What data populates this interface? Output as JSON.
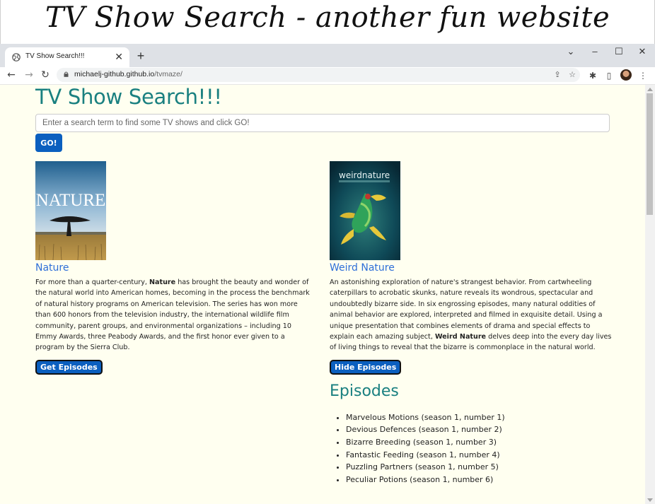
{
  "banner": {
    "title": "TV Show Search - another fun website"
  },
  "browser": {
    "tab_title": "TV Show Search!!!",
    "url_host": "michaelj-github.github.io",
    "url_path": "/tvmaze/"
  },
  "page": {
    "title": "TV Show Search!!!",
    "search_placeholder": "Enter a search term to find some TV shows and click GO!",
    "go_label": "GO!"
  },
  "shows": [
    {
      "name": "Nature",
      "poster_text": "NATURE",
      "summary_pre": "For more than a quarter-century, ",
      "summary_bold": "Nature",
      "summary_post": " has brought the beauty and wonder of the natural world into American homes, becoming in the process the benchmark of natural history programs on American television. The series has won more than 600 honors from the television industry, the international wildlife film community, parent groups, and environmental organizations – including 10 Emmy Awards, three Peabody Awards, and the first honor ever given to a program by the Sierra Club.",
      "button_label": "Get Episodes"
    },
    {
      "name": "Weird Nature",
      "poster_text": "weirdnature",
      "summary_pre": "An astonishing exploration of nature's strangest behavior. From cartwheeling caterpillars to acrobatic skunks, nature reveals its wondrous, spectacular and undoubtedly bizarre side. In six engrossing episodes, many natural oddities of animal behavior are explored, interpreted and filmed in exquisite detail. Using a unique presentation that combines elements of drama and special effects to explain each amazing subject, ",
      "summary_bold": "Weird Nature",
      "summary_post": " delves deep into the every day lives of living things to reveal that the bizarre is commonplace in the natural world.",
      "button_label": "Hide Episodes"
    }
  ],
  "episodes": {
    "title": "Episodes",
    "items": [
      "Marvelous Motions (season 1, number 1)",
      "Devious Defences (season 1, number 2)",
      "Bizarre Breeding (season 1, number 3)",
      "Fantastic Feeding (season 1, number 4)",
      "Puzzling Partners (season 1, number 5)",
      "Peculiar Potions (season 1, number 6)"
    ]
  },
  "colors": {
    "page_bg": "#fffff0",
    "title_teal": "#1a8080",
    "link_blue": "#2f6fd8",
    "button_blue": "#0b5fbf"
  }
}
